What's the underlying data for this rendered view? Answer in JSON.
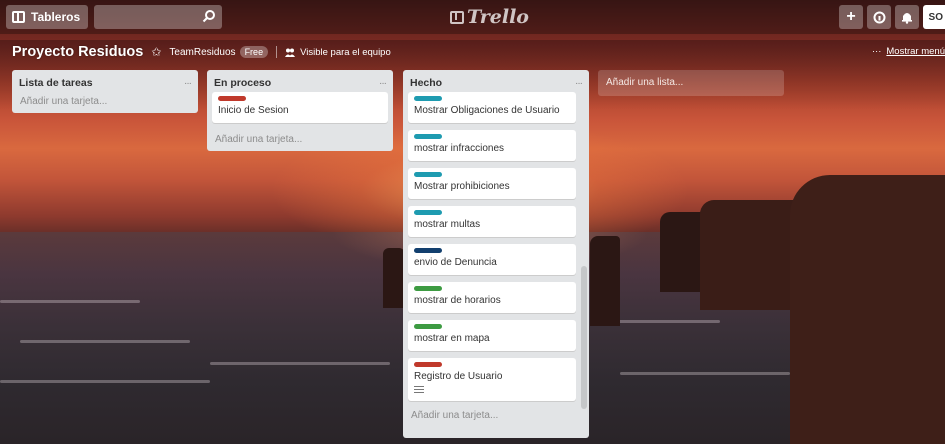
{
  "header": {
    "boards_label": "Tableros",
    "search_placeholder": "",
    "logo_text": "Trello",
    "add_label": "+",
    "info_label": "i",
    "avatar_initials": "SO"
  },
  "board": {
    "title": "Proyecto Residuos",
    "team_name": "TeamResiduos",
    "team_plan": "Free",
    "visibility": "Visible para el equipo",
    "menu_dots": "···",
    "menu_label": "Mostrar menú"
  },
  "lists": [
    {
      "title": "Lista de tareas",
      "menu": "···",
      "cards": [],
      "add_card": "Añadir una tarjeta..."
    },
    {
      "title": "En proceso",
      "menu": "···",
      "cards": [
        {
          "text": "Inicio de Sesion",
          "label_color": "#c0392b"
        }
      ],
      "add_card": "Añadir una tarjeta..."
    },
    {
      "title": "Hecho",
      "menu": "···",
      "cards": [
        {
          "text": "Mostrar Obligaciones de Usuario",
          "label_color": "#1e9bb0"
        },
        {
          "text": "mostrar infracciones",
          "label_color": "#1e9bb0"
        },
        {
          "text": "Mostrar prohibiciones",
          "label_color": "#1e9bb0"
        },
        {
          "text": "mostrar multas",
          "label_color": "#1e9bb0"
        },
        {
          "text": "envio de Denuncia",
          "label_color": "#123f6e"
        },
        {
          "text": "mostrar de horarios",
          "label_color": "#3d9b42"
        },
        {
          "text": "mostrar en mapa",
          "label_color": "#3d9b42"
        },
        {
          "text": "Registro de Usuario",
          "label_color": "#c0392b",
          "has_description": true
        }
      ],
      "add_card": "Añadir una tarjeta..."
    }
  ],
  "add_list_label": "Añadir una lista...",
  "colors": {
    "list_bg": "#e2e4e6",
    "header_overlay": "rgba(20,10,10,0.35)"
  },
  "icons": [
    "boards-icon",
    "search-icon",
    "trello-logo-icon",
    "plus-icon",
    "info-icon",
    "bell-icon",
    "star-icon",
    "lock-team-icon",
    "ellipsis-icon",
    "description-icon"
  ]
}
